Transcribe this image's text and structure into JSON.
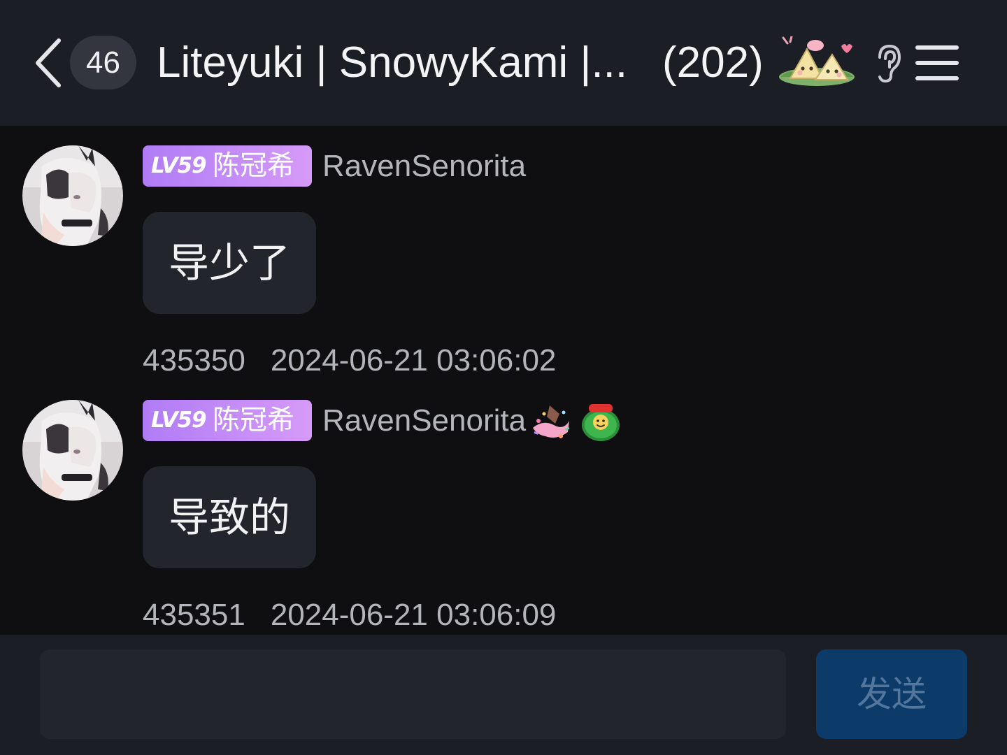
{
  "header": {
    "unread_count": "46",
    "title": "Liteyuki | SnowyKami |...",
    "member_count": "(202)",
    "sticker_icon": "rice-dumpling-sticker-icon",
    "ear_icon": "ear-icon",
    "menu_icon": "menu-icon",
    "back_icon": "chevron-left-icon"
  },
  "messages": [
    {
      "level": "LV59",
      "title": "陈冠希",
      "username": "RavenSenorita",
      "text": "导少了",
      "id": "435350",
      "timestamp": "2024-06-21 03:06:02"
    },
    {
      "level": "LV59",
      "title": "陈冠希",
      "username": "RavenSenorita",
      "text": "导致的",
      "id": "435351",
      "timestamp": "2024-06-21 03:06:09",
      "stickers": [
        "confetti-sticker-icon",
        "green-frog-sticker-icon"
      ]
    }
  ],
  "input": {
    "placeholder": "",
    "value": ""
  },
  "send_label": "发送",
  "colors": {
    "header_bg": "#1b1e25",
    "page_bg": "#0f0f11",
    "bubble_bg": "#23252c",
    "level_badge_start": "#b07cf6",
    "level_badge_end": "#d69af8",
    "send_bg": "#0c3a69",
    "send_text": "#53769c"
  }
}
